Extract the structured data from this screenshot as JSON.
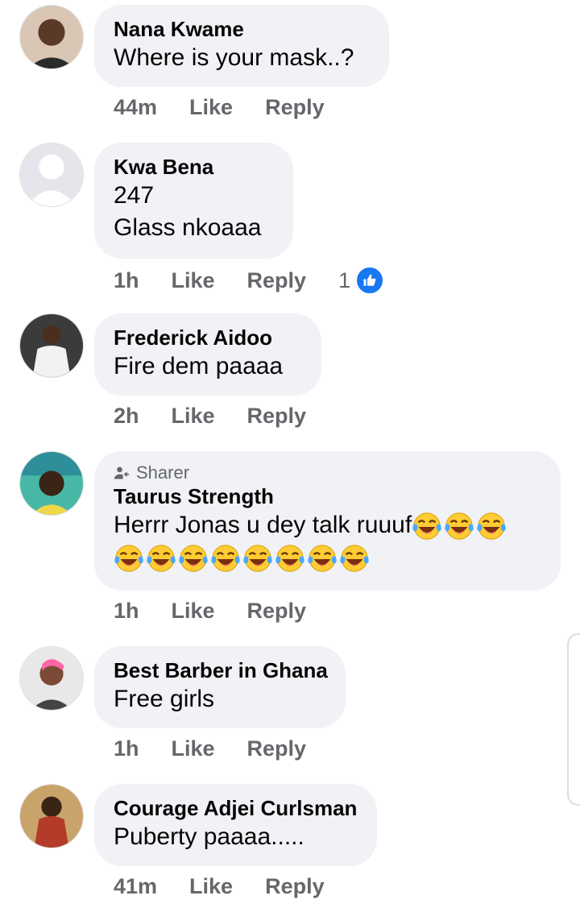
{
  "comments": [
    {
      "name": "Nana Kwame",
      "lines": [
        "Where is your mask..?"
      ],
      "time": "44m",
      "like": "Like",
      "reply": "Reply"
    },
    {
      "name": "Kwa Bena",
      "lines": [
        "247",
        "Glass nkoaaa"
      ],
      "time": "1h",
      "like": "Like",
      "reply": "Reply",
      "reaction_count": "1"
    },
    {
      "name": "Frederick Aidoo",
      "lines": [
        "Fire dem paaaa"
      ],
      "time": "2h",
      "like": "Like",
      "reply": "Reply"
    },
    {
      "name": "Taurus Strength",
      "badge": "Sharer",
      "lines": [
        "Herrr Jonas u dey talk ruuuf"
      ],
      "time": "1h",
      "like": "Like",
      "reply": "Reply"
    },
    {
      "name": "Best Barber in Ghana",
      "lines": [
        "Free girls"
      ],
      "time": "1h",
      "like": "Like",
      "reply": "Reply"
    },
    {
      "name": "Courage Adjei Curlsman",
      "lines": [
        "Puberty paaaa....."
      ],
      "time": "41m",
      "like": "Like",
      "reply": "Reply"
    }
  ],
  "colors": {
    "bubble": "#f0f2f5",
    "meta": "#65676b",
    "accent": "#1877f2",
    "text": "#050505"
  },
  "icons": {
    "reaction": "thumbs-up-icon",
    "sharer": "person-share-icon",
    "emoji": "tears-of-joy-emoji"
  }
}
